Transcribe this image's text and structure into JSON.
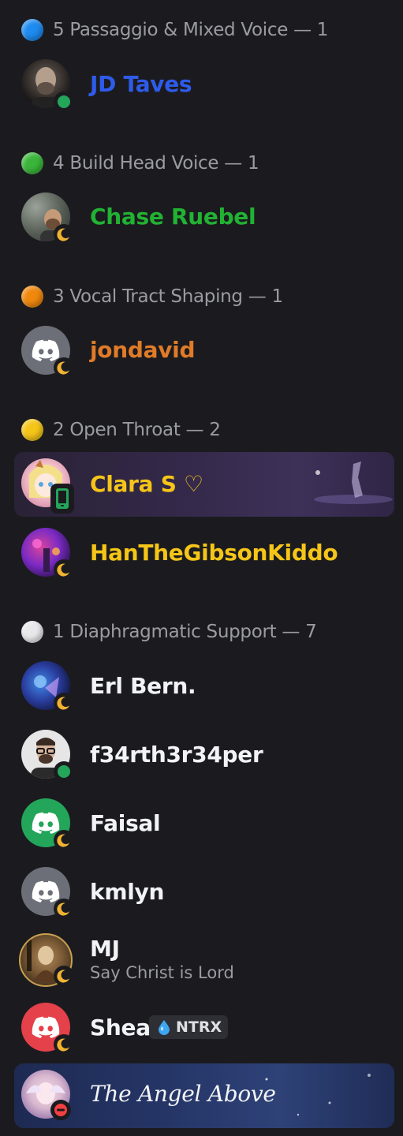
{
  "groups": [
    {
      "id": "g5",
      "dot_color": "#1e8bf0",
      "title": "5 Passaggio & Mixed Voice — 1"
    },
    {
      "id": "g4",
      "dot_color": "#3ab53a",
      "title": "4 Build Head Voice — 1"
    },
    {
      "id": "g3",
      "dot_color": "#f0880e",
      "title": "3 Vocal Tract Shaping — 1"
    },
    {
      "id": "g2",
      "dot_color": "#f5c518",
      "title": "2 Open Throat — 2"
    },
    {
      "id": "g1",
      "dot_color": "#e8e8ea",
      "title": "1 Diaphragmatic Support — 7"
    }
  ],
  "members": [
    {
      "name": "JD Taves",
      "color": "#2f5bea",
      "status": "online",
      "avatar": "photo-bald-man"
    },
    {
      "name": "Chase Ruebel",
      "color": "#22b233",
      "status": "idle",
      "avatar": "photo-man"
    },
    {
      "name": "jondavid",
      "color": "#e07b28",
      "status": "idle",
      "avatar": "discord-default-grey"
    },
    {
      "name": "Clara S ♡",
      "color": "#f5c518",
      "status": "mobile",
      "avatar": "anime-girl"
    },
    {
      "name": "HanTheGibsonKiddo",
      "color": "#f5c518",
      "status": "idle",
      "avatar": "concert-lights"
    },
    {
      "name": "Erl Bern.",
      "color": "#f2f3f5",
      "status": "idle",
      "avatar": "blue-art"
    },
    {
      "name": "f34rth3r34per",
      "color": "#f2f3f5",
      "status": "online",
      "avatar": "photo-glasses-man"
    },
    {
      "name": "Faisal",
      "color": "#f2f3f5",
      "status": "idle",
      "avatar": "discord-default-green"
    },
    {
      "name": "kmlyn",
      "color": "#f2f3f5",
      "status": "idle",
      "avatar": "discord-default-grey"
    },
    {
      "name": "MJ",
      "subtext": "Say Christ is Lord",
      "color": "#f2f3f5",
      "status": "idle",
      "avatar": "painting"
    },
    {
      "name": "Shea",
      "tag": "NTRX",
      "color": "#f2f3f5",
      "status": "idle",
      "avatar": "discord-default-red"
    },
    {
      "name": "The Angel Above",
      "color": "#f2f3f5",
      "status": "dnd",
      "avatar": "angel-art"
    }
  ]
}
